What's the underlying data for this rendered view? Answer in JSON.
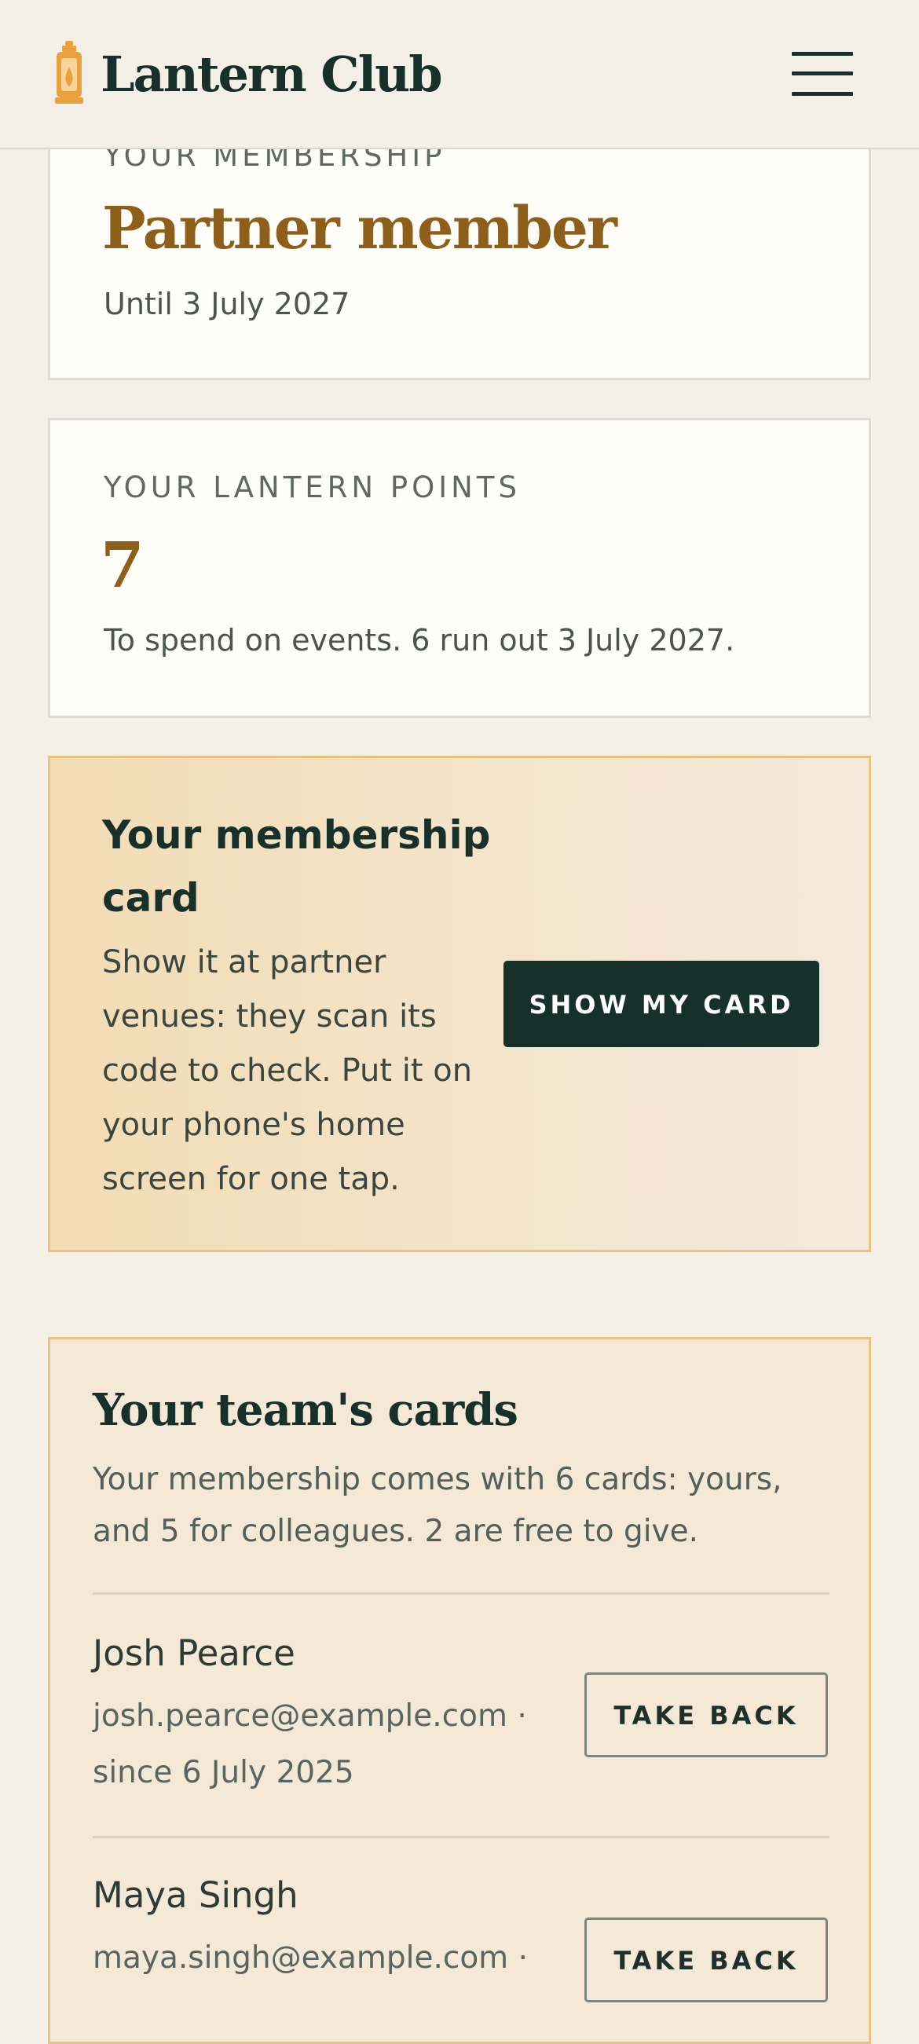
{
  "header": {
    "brand": "Lantern Club",
    "logo_icon": "lantern-icon",
    "menu_icon": "hamburger-menu-icon"
  },
  "membership": {
    "eyebrow": "YOUR MEMBERSHIP",
    "tier": "Partner member",
    "until": "Until 3 July 2027"
  },
  "points": {
    "eyebrow": "YOUR LANTERN POINTS",
    "value": "7",
    "note": "To spend on events. 6 run out 3 July 2027."
  },
  "membership_card": {
    "title": "Your membership card",
    "description": "Show it at partner venues: they scan its code to check. Put it on your phone's home screen for one tap.",
    "button_label": "SHOW MY CARD"
  },
  "team_cards": {
    "title": "Your team's cards",
    "description": "Your membership comes with 6 cards: yours, and 5 for colleagues. 2 are free to give.",
    "members": [
      {
        "name": "Josh Pearce",
        "meta": "josh.pearce@example.com · since 6 July 2025",
        "action_label": "TAKE BACK"
      },
      {
        "name": "Maya Singh",
        "meta": "maya.singh@example.com ·",
        "action_label": "TAKE BACK"
      }
    ]
  },
  "colors": {
    "brand_dark": "#17302a",
    "accent_gold": "#8e5f1b",
    "card_border": "#e8c37f",
    "page_bg": "#f4f0e7"
  }
}
